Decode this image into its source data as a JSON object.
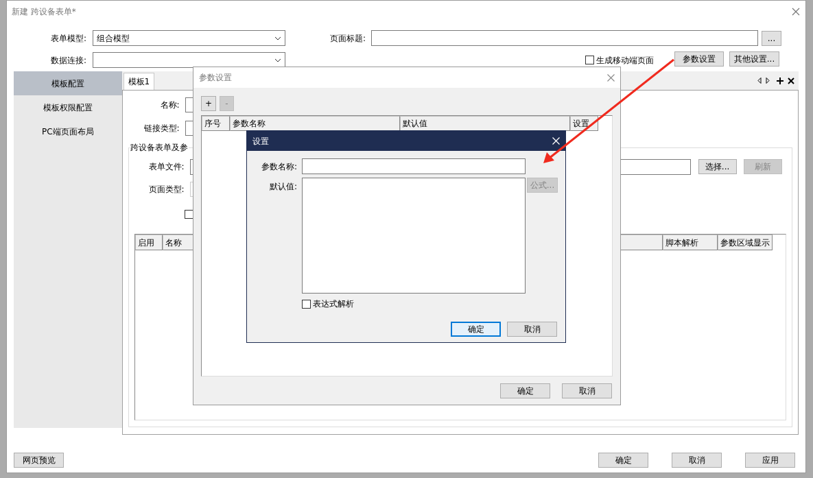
{
  "window": {
    "title": "新建 跨设备表单*"
  },
  "form": {
    "model_label": "表单模型:",
    "model_value": "组合模型",
    "page_title_label": "页面标题:",
    "page_title_button": "...",
    "data_conn_label": "数据连接:",
    "mobile_checkbox": {
      "label": "生成移动端页面",
      "checked": false
    },
    "param_button": "参数设置",
    "other_button": "其他设置..."
  },
  "sidebar": {
    "items": [
      {
        "label": "模板配置",
        "selected": true
      },
      {
        "label": "模板权限配置",
        "selected": false
      },
      {
        "label": "PC端页面布局",
        "selected": false
      }
    ]
  },
  "tabs": [
    {
      "label": "模板1",
      "selected": true
    }
  ],
  "template": {
    "name_label": "名称:",
    "link_label": "链接类型:",
    "group_label": "跨设备表单及参",
    "file_label": "表单文件:",
    "select_button": "选择...",
    "refresh_button": {
      "label": "刷新",
      "disabled": true
    },
    "page_type_label": "页面类型:",
    "option_checkbox": {
      "checked": false
    },
    "table": {
      "columns": [
        {
          "label": "启用"
        },
        {
          "label": "名称"
        },
        {
          "label": "脚本解析"
        },
        {
          "label": "参数区域显示"
        }
      ]
    }
  },
  "footer": {
    "preview_button": "网页预览",
    "buttons": [
      "确定",
      "取消",
      "应用"
    ]
  },
  "param_dialog": {
    "title": "参数设置",
    "add_button": "+",
    "remove_button": {
      "label": "-",
      "disabled": true
    },
    "columns": [
      "序号",
      "参数名称",
      "默认值",
      "设置"
    ],
    "buttons": [
      "确定",
      "取消"
    ]
  },
  "setting_dialog": {
    "title": "设置",
    "name_label": "参数名称:",
    "default_label": "默认值:",
    "formula_button": {
      "label": "公式...",
      "disabled": true
    },
    "expression_checkbox": {
      "label": "表达式解析",
      "checked": false
    },
    "buttons": [
      {
        "label": "确定",
        "default": true
      },
      {
        "label": "取消",
        "default": false
      }
    ]
  }
}
